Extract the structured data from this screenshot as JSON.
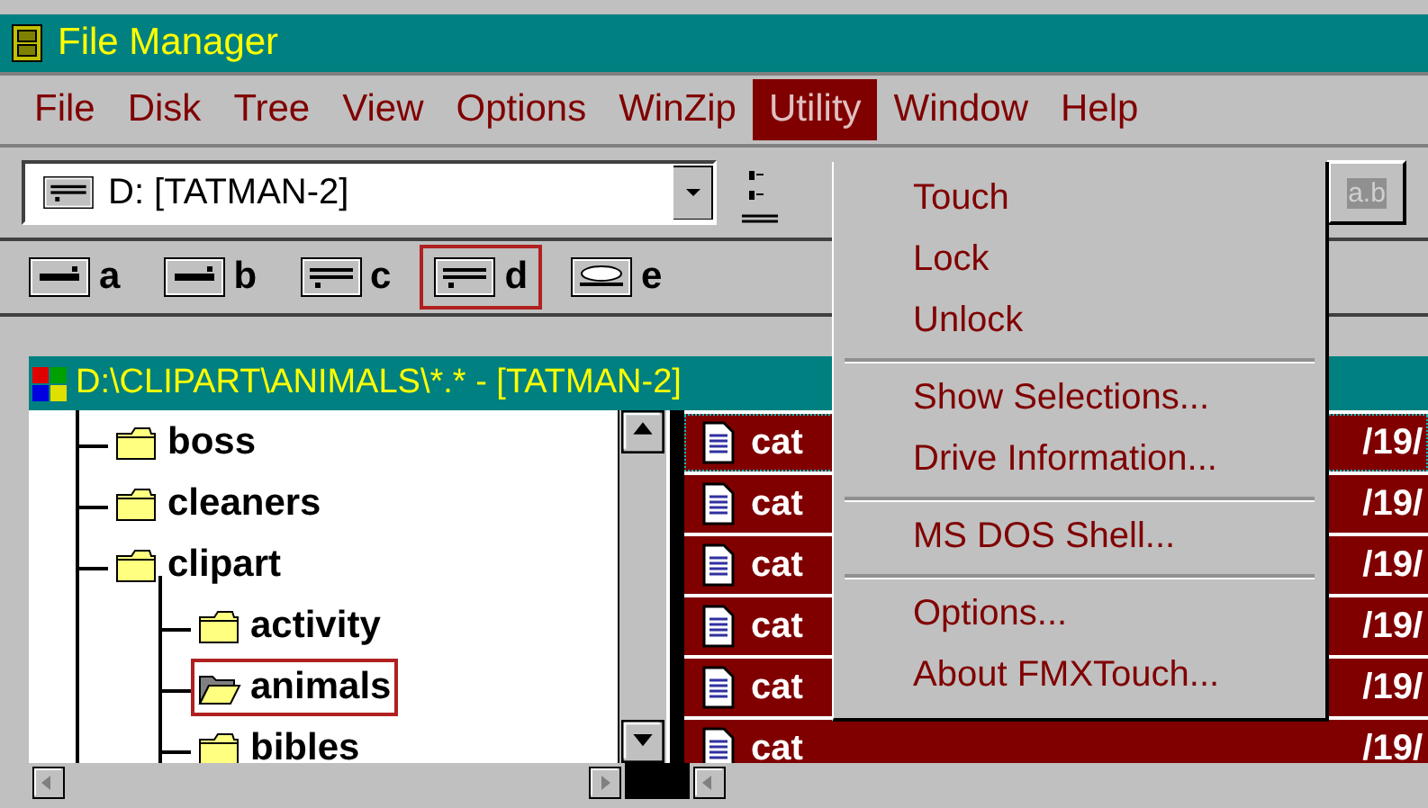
{
  "window": {
    "title": "File Manager"
  },
  "menu_bar": [
    {
      "label": "File",
      "selected": false
    },
    {
      "label": "Disk",
      "selected": false
    },
    {
      "label": "Tree",
      "selected": false
    },
    {
      "label": "View",
      "selected": false
    },
    {
      "label": "Options",
      "selected": false
    },
    {
      "label": "WinZip",
      "selected": false
    },
    {
      "label": "Utility",
      "selected": true
    },
    {
      "label": "Window",
      "selected": false
    },
    {
      "label": "Help",
      "selected": false
    }
  ],
  "utility_menu": {
    "groups": [
      [
        {
          "label": "Touch"
        },
        {
          "label": "Lock"
        },
        {
          "label": "Unlock"
        }
      ],
      [
        {
          "label": "Show Selections..."
        },
        {
          "label": "Drive Information..."
        }
      ],
      [
        {
          "label": "MS DOS Shell..."
        }
      ],
      [
        {
          "label": "Options..."
        },
        {
          "label": "About FMXTouch..."
        }
      ]
    ]
  },
  "drive_combo": {
    "value": "D: [TATMAN-2]"
  },
  "toolbar_button": {
    "label": "a.b",
    "disabled": true
  },
  "drives": [
    {
      "letter": "a",
      "kind": "floppy",
      "selected": false
    },
    {
      "letter": "b",
      "kind": "floppy",
      "selected": false
    },
    {
      "letter": "c",
      "kind": "hard",
      "selected": false
    },
    {
      "letter": "d",
      "kind": "hard",
      "selected": true
    },
    {
      "letter": "e",
      "kind": "cdrom",
      "selected": false
    }
  ],
  "directory_window": {
    "title": "D:\\CLIPART\\ANIMALS\\*.* - [TATMAN-2]",
    "tree": [
      {
        "name": "boss",
        "selected": false
      },
      {
        "name": "cleaners",
        "selected": false
      },
      {
        "name": "clipart",
        "selected": false,
        "children": [
          {
            "name": "activity",
            "selected": false
          },
          {
            "name": "animals",
            "selected": true
          },
          {
            "name": "bibles",
            "selected": false
          }
        ]
      }
    ],
    "files": [
      {
        "name": "cat",
        "column_2": "/19/",
        "selected": true,
        "focused": true
      },
      {
        "name": "cat",
        "column_2": "/19/",
        "selected": true,
        "focused": false
      },
      {
        "name": "cat",
        "column_2": "/19/",
        "selected": true,
        "focused": false
      },
      {
        "name": "cat",
        "column_2": "/19/",
        "selected": true,
        "focused": false
      },
      {
        "name": "cat",
        "column_2": "/19/",
        "selected": true,
        "focused": false
      },
      {
        "name": "cat",
        "column_2": "/19/",
        "selected": true,
        "focused": false
      }
    ]
  }
}
